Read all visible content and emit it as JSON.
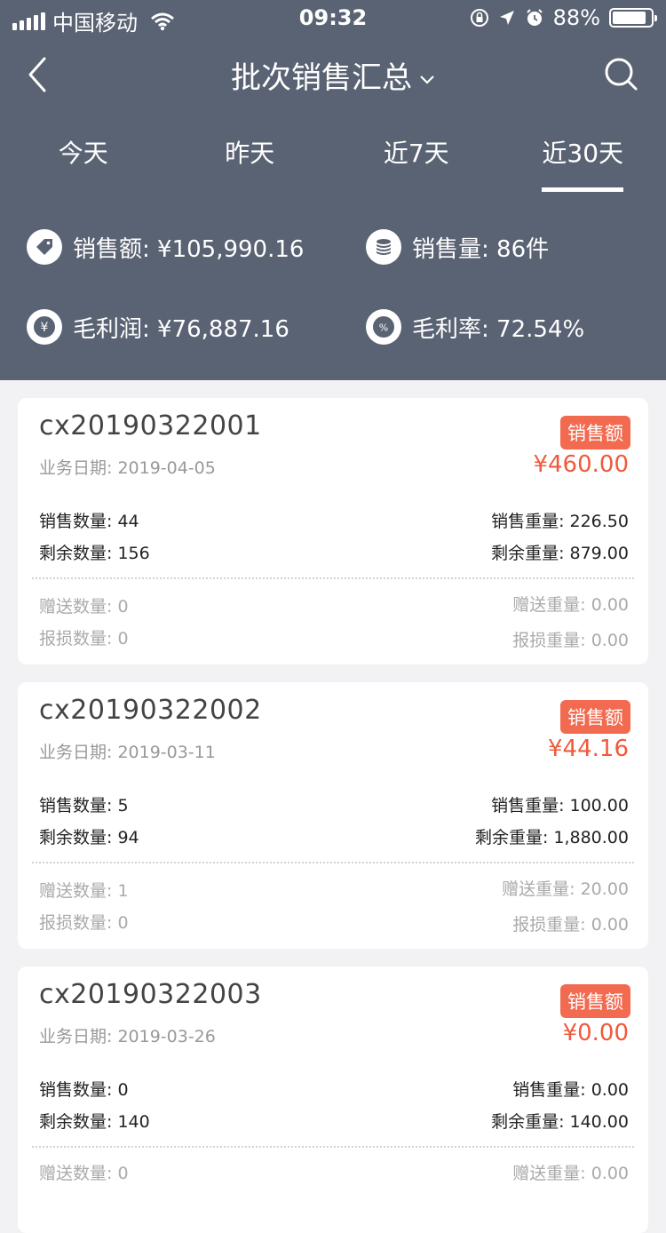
{
  "status_bar": {
    "carrier": "中国移动",
    "time": "09:32",
    "battery": "88%",
    "battery_level": 0.88
  },
  "nav": {
    "title": "批次销售汇总"
  },
  "tabs": [
    {
      "label": "今天",
      "active": false
    },
    {
      "label": "昨天",
      "active": false
    },
    {
      "label": "近7天",
      "active": false
    },
    {
      "label": "近30天",
      "active": true
    }
  ],
  "stats": {
    "sales_amount": "销售额: ¥105,990.16",
    "sales_volume": "销售量: 86件",
    "gross_profit": "毛利润: ¥76,887.16",
    "gross_margin": "毛利率: 72.54%"
  },
  "icons": {
    "yen_symbol": "¥",
    "percent_symbol": "%"
  },
  "badge_label": "销售额",
  "cards": [
    {
      "id": "cx20190322001",
      "date": "业务日期: 2019-04-05",
      "amount": "¥460.00",
      "sale_qty": "销售数量: 44",
      "remain_qty": "剩余数量: 156",
      "gift_qty": "赠送数量: 0",
      "loss_qty": "报损数量: 0",
      "sale_weight": "销售重量: 226.50",
      "remain_weight": "剩余重量: 879.00",
      "gift_weight": "赠送重量: 0.00",
      "loss_weight": "报损重量: 0.00"
    },
    {
      "id": "cx20190322002",
      "date": "业务日期: 2019-03-11",
      "amount": "¥44.16",
      "sale_qty": "销售数量: 5",
      "remain_qty": "剩余数量: 94",
      "gift_qty": "赠送数量: 1",
      "loss_qty": "报损数量: 0",
      "sale_weight": "销售重量: 100.00",
      "remain_weight": "剩余重量: 1,880.00",
      "gift_weight": "赠送重量: 20.00",
      "loss_weight": "报损重量: 0.00"
    },
    {
      "id": "cx20190322003",
      "date": "业务日期: 2019-03-26",
      "amount": "¥0.00",
      "sale_qty": "销售数量: 0",
      "remain_qty": "剩余数量: 140",
      "gift_qty": "赠送数量: 0",
      "sale_weight": "销售重量: 0.00",
      "remain_weight": "剩余重量: 140.00",
      "gift_weight": "赠送重量: 0.00"
    }
  ]
}
